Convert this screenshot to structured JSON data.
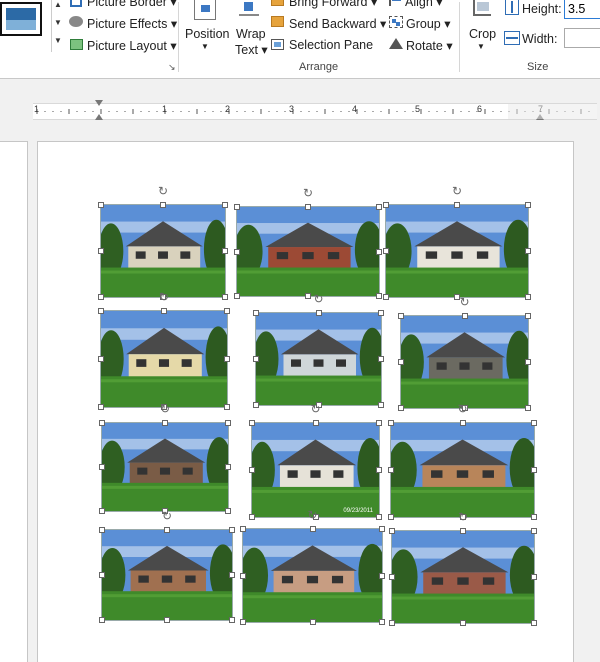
{
  "ribbon": {
    "picture_border_label": "Picture Border",
    "picture_effects_label": "Picture Effects",
    "picture_layout_label": "Picture Layout",
    "position_label": "Position",
    "wrap_text_label_1": "Wrap",
    "wrap_text_label_2": "Text",
    "bring_forward_label": "Bring Forward",
    "send_backward_label": "Send Backward",
    "selection_pane_label": "Selection Pane",
    "align_label": "Align",
    "group_label": "Group",
    "rotate_label": "Rotate",
    "crop_label": "Crop",
    "height_label": "Height:",
    "height_value": "3.5",
    "width_label": "Width:",
    "width_value": "",
    "arrange_group_label": "Arrange",
    "size_group_label": "Size"
  },
  "ruler": {
    "numbers": [
      "1",
      "1",
      "2",
      "3",
      "4",
      "5",
      "6",
      "7"
    ]
  },
  "photos": [
    {
      "name": "house-photo-1"
    },
    {
      "name": "house-photo-2"
    },
    {
      "name": "house-photo-3"
    },
    {
      "name": "house-photo-4"
    },
    {
      "name": "house-photo-5"
    },
    {
      "name": "house-photo-6"
    },
    {
      "name": "house-photo-7"
    },
    {
      "name": "house-photo-8",
      "caption": "09/23/2011"
    },
    {
      "name": "house-photo-9"
    },
    {
      "name": "house-photo-10"
    },
    {
      "name": "house-photo-11"
    },
    {
      "name": "house-photo-12"
    }
  ],
  "colors": {
    "sky": "#5b8fd6",
    "grass": "#3f8a2a",
    "brick": "#9c4a35",
    "siding": "#d9d2bd"
  }
}
